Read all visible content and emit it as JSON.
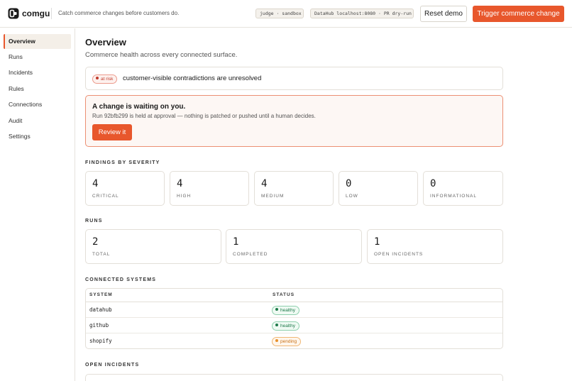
{
  "app": {
    "brand": "comgu",
    "tagline": "Catch commerce changes before customers do.",
    "env_chip": "judge · sandbox",
    "datahub_chip": "DataHub localhost:8080 · PR dry-run",
    "reset_label": "Reset demo",
    "trigger_label": "Trigger commerce change"
  },
  "sidebar": {
    "items": [
      {
        "label": "Overview",
        "active": true
      },
      {
        "label": "Runs"
      },
      {
        "label": "Incidents"
      },
      {
        "label": "Rules"
      },
      {
        "label": "Connections"
      },
      {
        "label": "Audit"
      },
      {
        "label": "Settings"
      }
    ]
  },
  "main": {
    "title": "Overview",
    "subtitle": "Commerce health across every connected surface.",
    "risk": {
      "badge": "at risk",
      "text": "customer-visible contradictions are unresolved"
    },
    "waiting": {
      "title": "A change is waiting on you.",
      "desc": "Run 92bfb299 is held at approval — nothing is patched or pushed until a human decides.",
      "button": "Review it"
    },
    "findings": {
      "label": "FINDINGS BY SEVERITY",
      "items": [
        {
          "value": "4",
          "label": "CRITICAL"
        },
        {
          "value": "4",
          "label": "HIGH"
        },
        {
          "value": "4",
          "label": "MEDIUM"
        },
        {
          "value": "0",
          "label": "LOW"
        },
        {
          "value": "0",
          "label": "INFORMATIONAL"
        }
      ]
    },
    "runs": {
      "label": "RUNS",
      "items": [
        {
          "value": "2",
          "label": "TOTAL"
        },
        {
          "value": "1",
          "label": "COMPLETED"
        },
        {
          "value": "1",
          "label": "OPEN INCIDENTS"
        }
      ]
    },
    "systems": {
      "label": "CONNECTED SYSTEMS",
      "col_system": "SYSTEM",
      "col_status": "STATUS",
      "rows": [
        {
          "system": "datahub",
          "status": "healthy"
        },
        {
          "system": "github",
          "status": "healthy"
        },
        {
          "system": "shopify",
          "status": "pending"
        }
      ]
    },
    "open_incidents": {
      "label": "OPEN INCIDENTS"
    }
  },
  "colors": {
    "accent": "#e8572c",
    "healthy": "#1e7a4a",
    "pending": "#c8721a",
    "risk": "#c0392b"
  }
}
